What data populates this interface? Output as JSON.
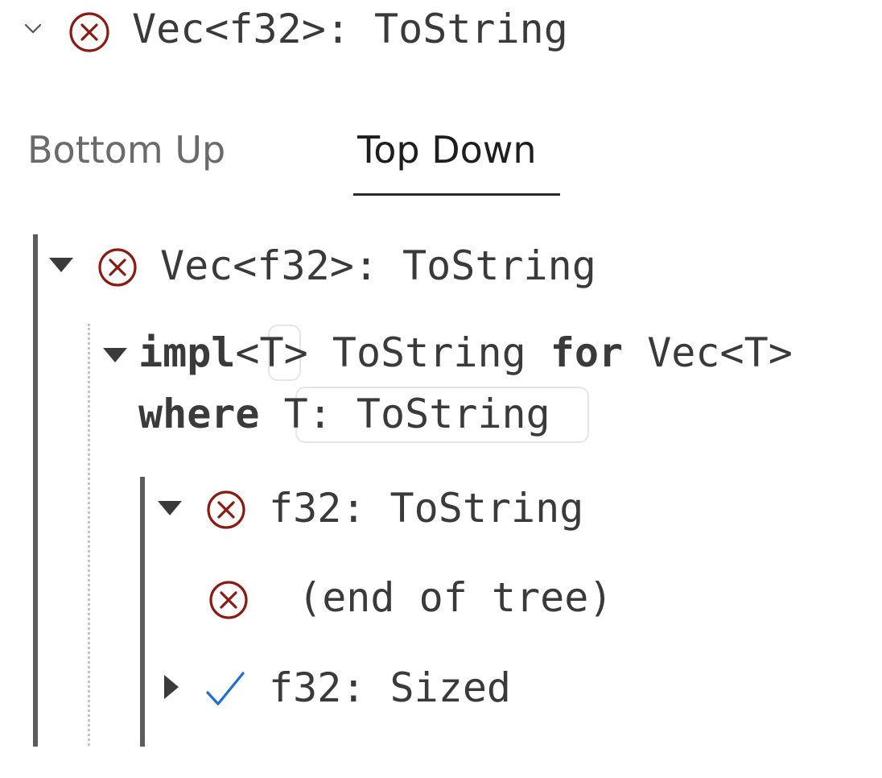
{
  "header": {
    "collapse_icon": "chevron-down-icon",
    "status_icon": "error-circle-x-icon",
    "title": "Vec<f32>: ToString"
  },
  "tabs": [
    {
      "label": "Bottom Up",
      "active": false
    },
    {
      "label": "Top Down",
      "active": true
    }
  ],
  "tree": {
    "root": {
      "expanded": true,
      "status_icon": "error-circle-x-icon",
      "label": "Vec<f32>: ToString"
    },
    "impl_node": {
      "expanded": true,
      "kw_impl": "impl",
      "lt": "<",
      "type_var": "T",
      "gt": ">",
      "trait": " ToString ",
      "kw_for": "for",
      "target": " Vec<T>",
      "kw_where": "where",
      "bound": "T: ToString"
    },
    "children": [
      {
        "expanded": true,
        "status_icon": "error-circle-x-icon",
        "label": "f32: ToString"
      },
      {
        "status_icon": "error-circle-x-icon",
        "label": " (end of tree)"
      },
      {
        "expanded": false,
        "status_icon": "check-icon",
        "label": "f32: Sized"
      }
    ]
  },
  "colors": {
    "error": "#8b1a10",
    "success": "#1f6fd1",
    "text": "#3a3a3a",
    "tab_inactive": "#6a6a6a",
    "tab_active": "#1e1e1e"
  }
}
